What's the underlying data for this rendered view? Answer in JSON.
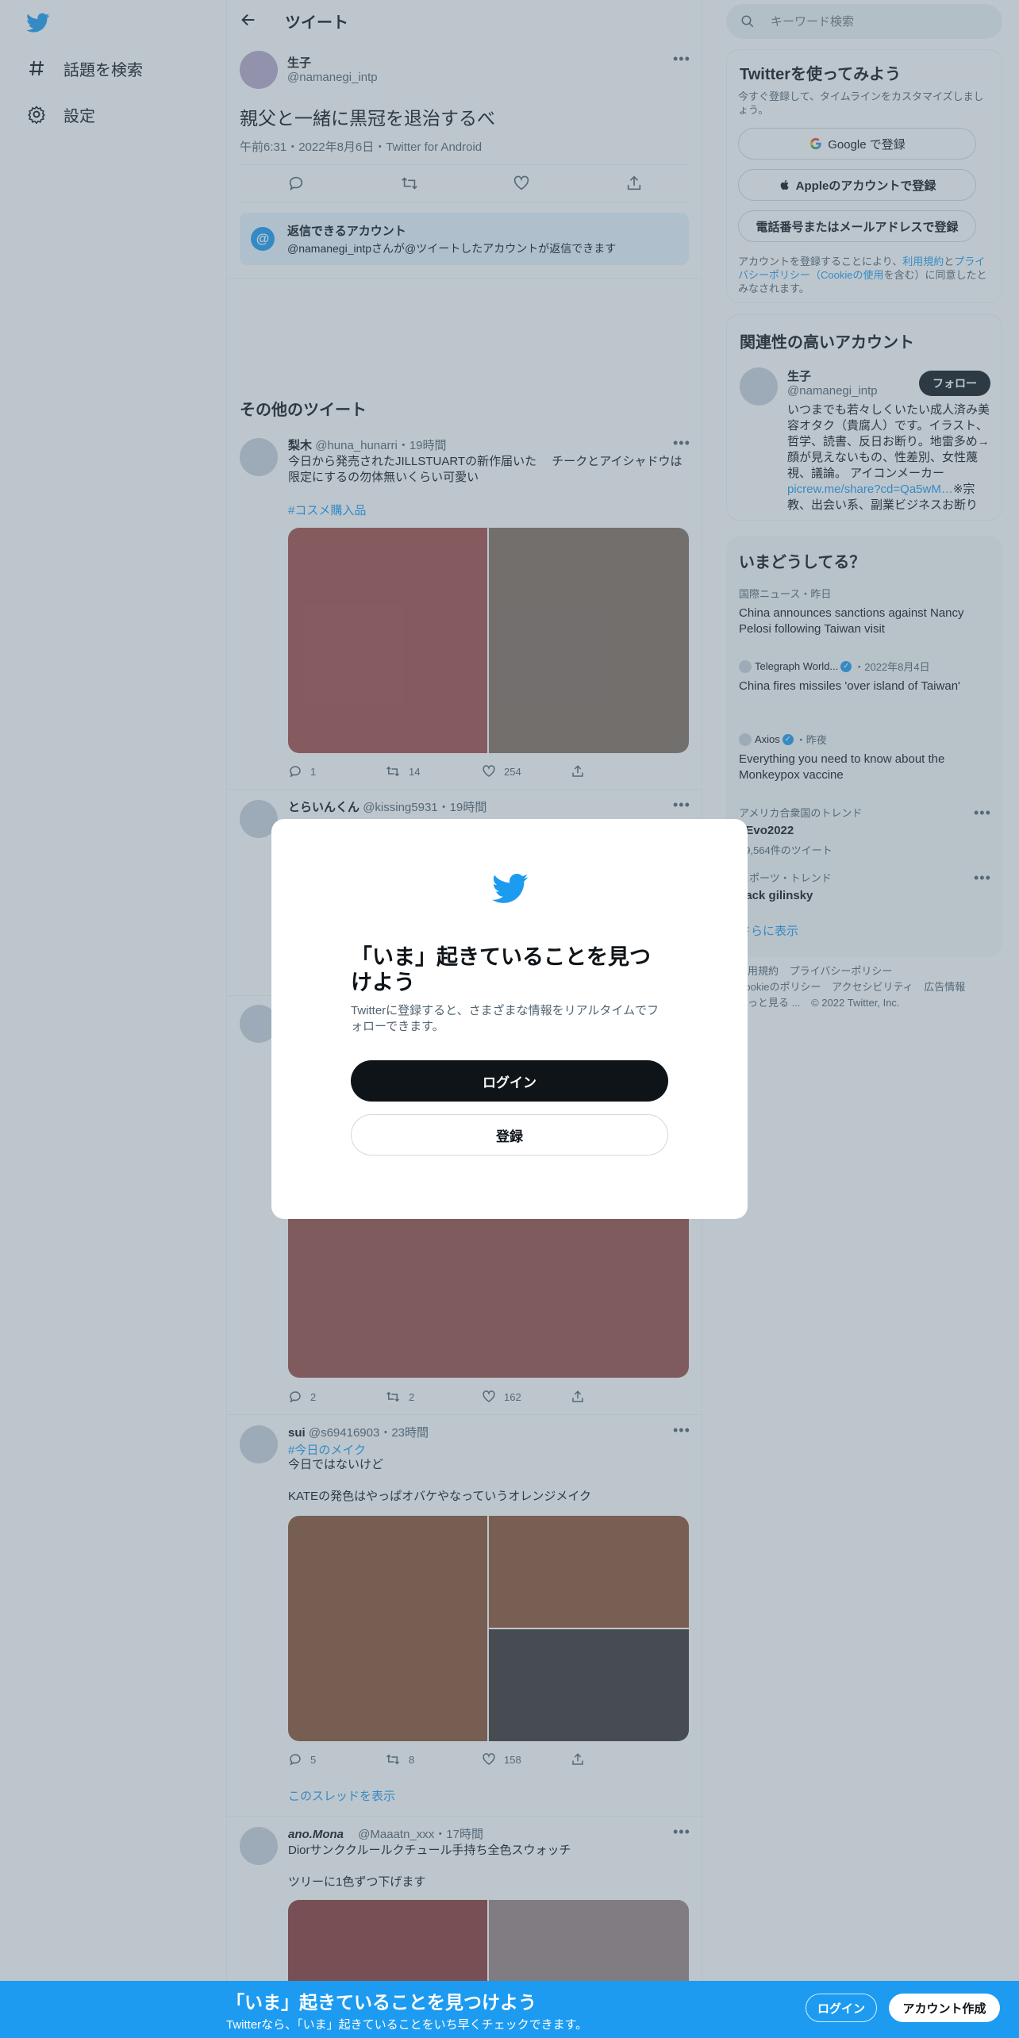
{
  "nav": {
    "explore": "話題を検索",
    "settings": "設定"
  },
  "header": {
    "title": "ツイート"
  },
  "main_tweet": {
    "name": "生子",
    "handle": "@namanegi_intp",
    "text": "親父と一緒に黒冠を退治するべ",
    "meta": "午前6:31・2022年8月6日・Twitter for Android"
  },
  "reply_notice": {
    "title": "返信できるアカウント",
    "body": "@namanegi_intpさんが@ツイートしたアカウントが返信できます"
  },
  "more_tweets_heading": "その他のツイート",
  "tweets": [
    {
      "name": "梨木",
      "handle": "@huna_hunarri",
      "time": "・19時間",
      "text": "今日から発売されたJILLSTUARTの新作届いた　 チークとアイシャドウは限定にするの勿体無いくらい可愛い",
      "hashtag": "#コスメ購入品",
      "replies": "1",
      "retweets": "14",
      "likes": "254"
    },
    {
      "name": "とらいんくん",
      "handle": "@kissing5931",
      "time": "・19時間",
      "replies": "2",
      "retweets": "2",
      "likes": "162"
    },
    {
      "name": "sui",
      "handle": "@s69416903",
      "time": "・23時間",
      "hashtag": "#今日のメイク",
      "text1": "今日ではないけど",
      "text2": "KATEの発色はやっぱオバケやなっていうオレンジメイク",
      "replies": "5",
      "retweets": "8",
      "likes": "158",
      "thread_link": "このスレッドを表示"
    },
    {
      "name": "ano.Mona",
      "handle": "@Maaatn_xxx",
      "time": "・17時間",
      "text1": "Diorサンククルールクチュール手持ち全色スウォッチ",
      "text2": "ツリーに1色ずつ下げます"
    }
  ],
  "search": {
    "placeholder": "キーワード検索"
  },
  "signup_panel": {
    "title": "Twitterを使ってみよう",
    "subtitle": "今すぐ登録して、タイムラインをカスタマイズしましょう。",
    "google": "Google で登録",
    "apple": "Appleのアカウントで登録",
    "phone": "電話番号またはメールアドレスで登録",
    "terms_pre": "アカウントを登録することにより、",
    "terms_link1": "利用規約",
    "terms_and": "と",
    "terms_link2": "プライバシーポリシー（Cookieの使用",
    "terms_post": "を含む）に同意したとみなされます。"
  },
  "related": {
    "title": "関連性の高いアカウント",
    "name": "生子",
    "handle": "@namanegi_intp",
    "follow": "フォロー",
    "bio": "いつまでも若々しくいたい成人済み美容オタク（貴腐人）です。イラスト、哲学、読書、反日お断り。地雷多め→顔が見えないもの、性差別、女性蔑視、議論。 アイコンメーカー",
    "bio_link": "picrew.me/share?cd=Qa5wM…",
    "bio_tail": "※宗教、出会い系、副業ビジネスお断り"
  },
  "whats_happening": {
    "title": "いまどうしてる？",
    "items": [
      {
        "meta": "国際ニュース・昨日",
        "title": "China announces sanctions against Nancy Pelosi following Taiwan visit"
      },
      {
        "source": "Telegraph World...",
        "meta": "・2022年8月4日",
        "title": "China fires missiles 'over island of Taiwan'"
      },
      {
        "source": "Axios",
        "meta": "・昨夜",
        "title": "Everything you need to know about the Monkeypox vaccine"
      },
      {
        "meta": "アメリカ合衆国のトレンド",
        "title": "#Evo2022",
        "count": "59,564件のツイート"
      },
      {
        "meta": "スポーツ・トレンド",
        "title": "Jack gilinsky"
      }
    ],
    "show_more": "さらに表示"
  },
  "footer": {
    "line1": [
      "利用規約",
      "プライバシーポリシー"
    ],
    "line2": [
      "Cookieのポリシー",
      "アクセシビリティ",
      "広告情報"
    ],
    "line3": [
      "もっと見る ...",
      "© 2022 Twitter, Inc."
    ]
  },
  "modal": {
    "title": "「いま」起きていることを見つけよう",
    "subtitle": "Twitterに登録すると、さまざまな情報をリアルタイムでフォローできます。",
    "login": "ログイン",
    "signup": "登録"
  },
  "bottom_bar": {
    "title": "「いま」起きていることを見つけよう",
    "subtitle": "Twitterなら、「いま」起きていることをいち早くチェックできます。",
    "login": "ログイン",
    "signup": "アカウント作成"
  },
  "colors": {
    "accent": "#1d9bf0",
    "overlay": "rgba(91,112,131,0.4)",
    "dark_button": "#0f1419"
  }
}
